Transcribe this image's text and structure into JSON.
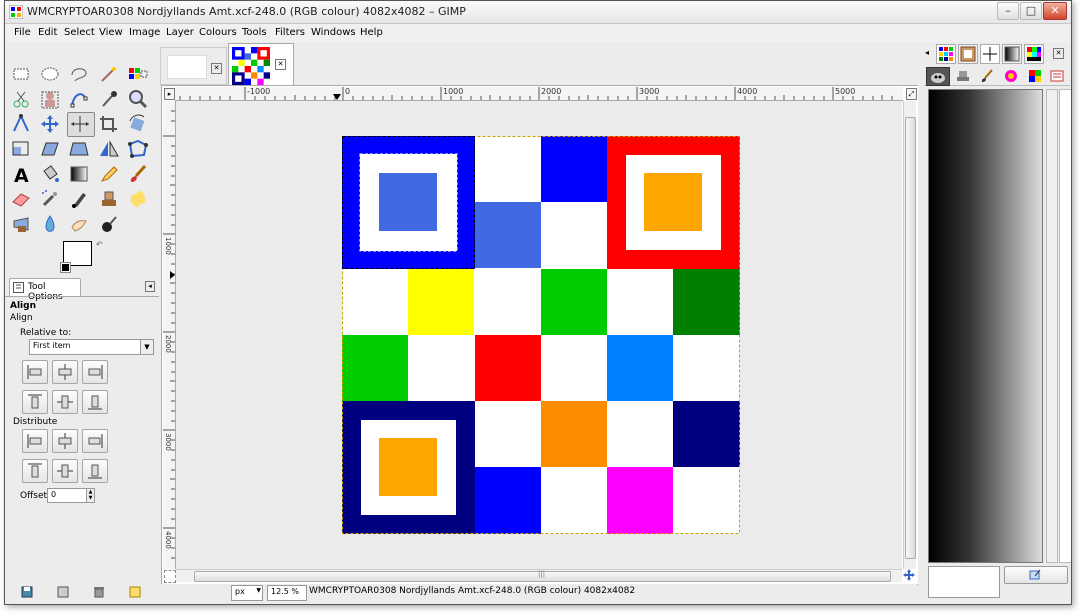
{
  "window": {
    "title": "WMCRYPTOAR0308 Nordjyllands Amt.xcf-248.0 (RGB colour) 4082x4082 – GIMP",
    "minimize": "–",
    "maximize": "□",
    "close": "✕"
  },
  "menu": [
    "File",
    "Edit",
    "Select",
    "View",
    "Image",
    "Layer",
    "Colours",
    "Tools",
    "Filters",
    "Windows",
    "Help"
  ],
  "tool_options": {
    "tab_label": "Tool Options",
    "tool_name": "Align",
    "subtitle": "Align",
    "relative_to_label": "Relative to:",
    "relative_to_value": "First item",
    "distribute_label": "Distribute",
    "offset_label": "Offset:",
    "offset_value": "0"
  },
  "ruler": {
    "h_ticks": [
      "-1000",
      "0",
      "1000",
      "2000",
      "3000",
      "4000",
      "5000"
    ],
    "v_ticks": [
      "1000",
      "2000",
      "3000",
      "4000"
    ]
  },
  "status": {
    "unit": "px",
    "zoom": "12.5 %",
    "message": "WMCRYPTOAR0308 Nordjyllands Amt.xcf-248.0 (RGB colour) 4082x4082"
  },
  "colors": {
    "blue": "#0000FF",
    "navy": "#000080",
    "red": "#FF0000",
    "yellow": "#FFFF00",
    "green": "#00CC00",
    "dark_green": "#008000",
    "azure": "#0080FF",
    "orange": "#FF8C00",
    "gold": "#FFA500",
    "magenta": "#FF00FF",
    "royal": "#4169E1"
  }
}
